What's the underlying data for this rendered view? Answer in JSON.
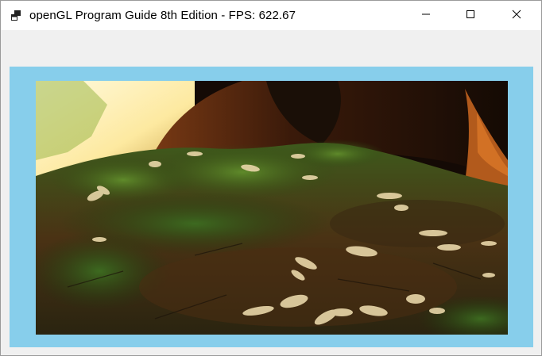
{
  "window": {
    "title": "openGL Program Guide 8th Edition - FPS: 622.67",
    "app_icon": "windows-app-icon",
    "controls": {
      "minimize_icon": "minimize-icon",
      "maximize_icon": "maximize-icon",
      "close_icon": "close-icon"
    }
  },
  "viewport": {
    "clear_color": "#87ceeb",
    "texture_description_icon": "forest-floor-texture"
  }
}
